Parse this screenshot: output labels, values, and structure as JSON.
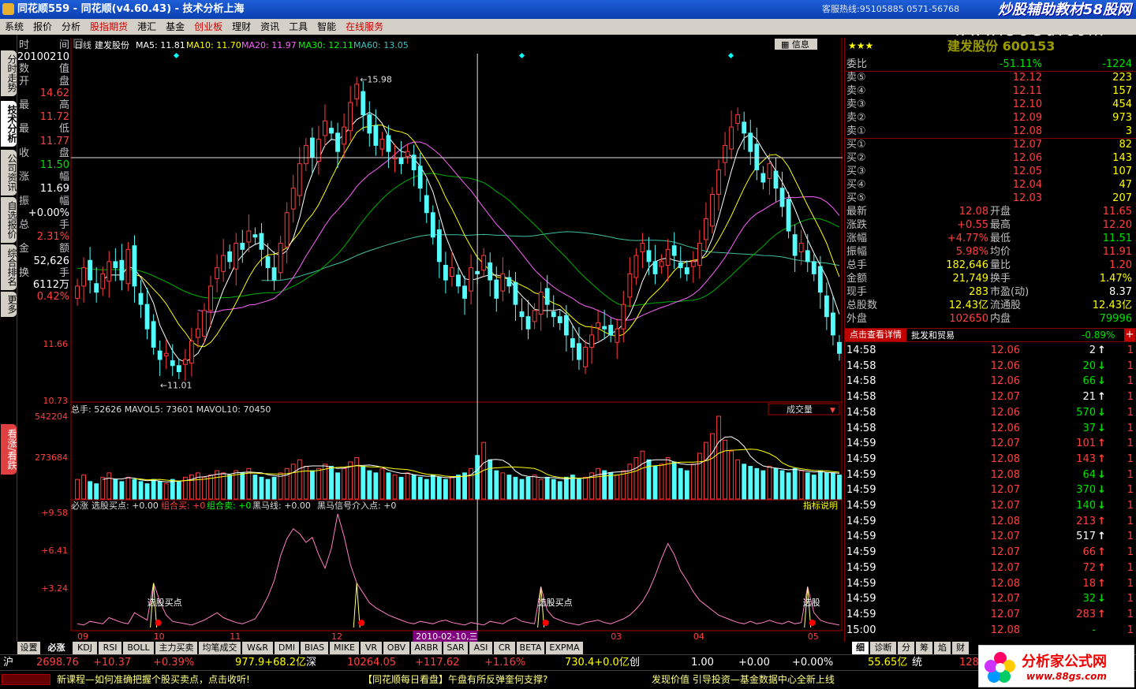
{
  "window": {
    "title": "同花顺559 - 同花顺(v4.60.43) - 技术分析上海",
    "hotline": "客服热线:95105885 0571-56768",
    "watermark": "炒股辅助教材58股网",
    "watermark_url": "www.58Gu.com"
  },
  "menu": [
    "系统",
    "报价",
    "分析",
    "股指期货",
    "港汇",
    "基金",
    "创业板",
    "理财",
    "资讯",
    "工具",
    "智能",
    "在线服务"
  ],
  "left_tabs": [
    "分时走势",
    "技术分析",
    "公司资讯",
    "自选报价",
    "综合排名",
    "更多"
  ],
  "left_tab_bottom": "看涨/看跌",
  "chart_header": {
    "period": "日线",
    "name": "建发股份",
    "ma5": "MA5: 11.81",
    "ma10": "MA10: 11.70",
    "ma20": "MA20: 11.97",
    "ma30": "MA30: 12.11",
    "ma60": "MA60: 13.05",
    "info_btn": "信息"
  },
  "info_panel": [
    {
      "k": "时",
      "v": "间"
    },
    {
      "k": "",
      "v": "20100210"
    },
    {
      "k": "数",
      "v": "值"
    },
    {
      "k": "开",
      "v": "盘"
    },
    {
      "k": "",
      "v": "14.62"
    },
    {
      "k": "最",
      "v": "高"
    },
    {
      "k": "",
      "v": "11.72"
    },
    {
      "k": "最",
      "v": "低"
    },
    {
      "k": "",
      "v": "11.77"
    },
    {
      "k": "收",
      "v": "盘"
    },
    {
      "k": "",
      "v": "11.50"
    },
    {
      "k": "涨",
      "v": "幅"
    },
    {
      "k": "",
      "v": "11.69"
    },
    {
      "k": "振",
      "v": "幅"
    },
    {
      "k": "",
      "v": "+0.00%"
    },
    {
      "k": "总",
      "v": "手"
    },
    {
      "k": "",
      "v": "2.31%"
    },
    {
      "k": "金",
      "v": "额"
    },
    {
      "k": "",
      "v": "52,626"
    },
    {
      "k": "换",
      "v": "手"
    },
    {
      "k": "",
      "v": "6112万"
    },
    {
      "k": "",
      "v": "0.42%"
    }
  ],
  "price_axis": {
    "high_label": "15.98",
    "low_label": "11.01",
    "y_mid": "11.66",
    "y_bottom": "10.73"
  },
  "volume_header": {
    "text": "总手: 52626 MAVOL5: 73601 MAVOL10: 70450",
    "selector": "成交量",
    "y_top": "542204",
    "y_mid": "273684"
  },
  "indicator_header": {
    "name": "必涨",
    "fields": "选股买点: +0.00",
    "combo_buy": "组合买: +0",
    "combo_sell": "组合卖: +0",
    "black_horse": "黑马线: +0.00",
    "signal": "黑马信号介入点: +0",
    "help": "指标说明",
    "y1": "+9.58",
    "y2": "+6.41",
    "y3": "+3.24",
    "buy_marker": "选股买点",
    "buy_marker2": "选股"
  },
  "x_axis": [
    "09",
    "10",
    "11",
    "12",
    "01",
    "03",
    "04",
    "05"
  ],
  "crosshair_date": "2010-02-10,三",
  "chart_data": {
    "type": "candlestick",
    "title": "建发股份 日线",
    "price_range": [
      10.73,
      16.4
    ],
    "labeled_high": 15.98,
    "labeled_low": 11.01,
    "closes": [
      12.6,
      12.9,
      12.7,
      12.5,
      12.8,
      13.0,
      12.9,
      12.7,
      13.2,
      12.6,
      12.3,
      11.9,
      11.6,
      11.4,
      11.5,
      11.3,
      11.2,
      11.4,
      11.7,
      11.9,
      12.2,
      12.6,
      12.9,
      13.1,
      13.0,
      13.3,
      13.2,
      13.5,
      13.4,
      13.2,
      12.9,
      12.7,
      13.3,
      13.8,
      14.2,
      14.6,
      14.9,
      14.7,
      15.0,
      15.3,
      15.1,
      14.8,
      15.2,
      15.6,
      15.9,
      15.4,
      15.1,
      14.9,
      15.0,
      14.8,
      14.7,
      14.6,
      14.8,
      14.5,
      14.2,
      13.8,
      13.4,
      13.0,
      12.7,
      12.9,
      12.6,
      12.4,
      12.9,
      12.8,
      13.1,
      12.7,
      12.4,
      12.8,
      12.6,
      12.3,
      12.1,
      11.9,
      12.2,
      12.5,
      12.3,
      12.1,
      12.0,
      11.8,
      11.6,
      11.4,
      11.6,
      11.8,
      12.0,
      11.9,
      11.8,
      11.9,
      12.3,
      12.8,
      13.1,
      13.3,
      13.0,
      12.8,
      13.0,
      13.2,
      13.1,
      12.9,
      12.8,
      13.0,
      13.3,
      13.7,
      14.1,
      14.5,
      14.9,
      15.2,
      15.4,
      15.1,
      14.8,
      14.5,
      14.3,
      14.6,
      14.2,
      13.9,
      13.5,
      13.1,
      13.3,
      13.0,
      12.8,
      12.5,
      12.1,
      11.8,
      11.5
    ],
    "volume_range": [
      0,
      542204
    ],
    "volumes": [
      9,
      11,
      8,
      7,
      10,
      12,
      9,
      8,
      10,
      9,
      8,
      7,
      9,
      8,
      7,
      9,
      8,
      10,
      11,
      12,
      10,
      11,
      13,
      12,
      11,
      13,
      12,
      14,
      11,
      10,
      9,
      10,
      12,
      14,
      16,
      18,
      15,
      13,
      14,
      16,
      15,
      12,
      14,
      17,
      19,
      15,
      13,
      12,
      14,
      12,
      11,
      10,
      12,
      11,
      10,
      9,
      11,
      10,
      9,
      10,
      11,
      12,
      14,
      20,
      26,
      18,
      13,
      12,
      11,
      10,
      9,
      10,
      11,
      9,
      10,
      9,
      8,
      10,
      11,
      9,
      10,
      12,
      14,
      13,
      12,
      11,
      13,
      16,
      19,
      22,
      18,
      15,
      16,
      19,
      17,
      14,
      13,
      16,
      21,
      26,
      30,
      38,
      27,
      22,
      18,
      16,
      15,
      14,
      13,
      15,
      14,
      13,
      12,
      14,
      13,
      12,
      11,
      13,
      12,
      12,
      11
    ],
    "indicator_range": [
      0,
      9.58
    ],
    "indicator": [
      0.3,
      0.2,
      0.5,
      0.4,
      0.3,
      0.8,
      0.6,
      0.4,
      0.3,
      1.2,
      0.9,
      0.6,
      3.6,
      2.1,
      1.0,
      0.5,
      0.4,
      0.3,
      0.2,
      0.4,
      0.6,
      0.9,
      1.2,
      0.8,
      0.6,
      0.4,
      0.3,
      0.5,
      0.7,
      1.5,
      2.5,
      3.8,
      5.8,
      7.2,
      8.0,
      7.6,
      6.9,
      7.3,
      5.9,
      4.8,
      6.4,
      9.2,
      7.4,
      5.1,
      3.6,
      2.8,
      2.0,
      1.6,
      1.3,
      1.0,
      0.8,
      0.6,
      0.4,
      0.3,
      0.5,
      0.4,
      0.3,
      0.5,
      0.6,
      0.4,
      0.3,
      0.2,
      0.4,
      0.3,
      0.2,
      0.5,
      0.4,
      0.3,
      0.6,
      0.8,
      0.5,
      0.4,
      0.3,
      3.3,
      1.4,
      0.8,
      0.6,
      0.4,
      0.3,
      0.2,
      0.4,
      0.5,
      0.6,
      0.4,
      0.3,
      0.5,
      0.7,
      1.0,
      1.5,
      2.1,
      3.0,
      4.2,
      5.6,
      6.8,
      5.9,
      4.6,
      3.8,
      2.9,
      2.2,
      1.8,
      1.4,
      1.0,
      0.8,
      0.6,
      0.4,
      0.3,
      0.5,
      0.3,
      0.4,
      0.6,
      0.4,
      0.3,
      0.5,
      0.3,
      0.4,
      3.3,
      1.2,
      0.6,
      0.4,
      0.3,
      0.2
    ]
  },
  "stock_panel": {
    "title": "建发股份 600153",
    "stars": "★★★",
    "order_book": [
      {
        "k": "委比",
        "v": "-51.11%",
        "n": "-1224",
        "vc": "grn",
        "nc": "grn"
      },
      {
        "k": "卖⑤",
        "v": "12.12",
        "n": "223",
        "vc": "red",
        "nc": "yel"
      },
      {
        "k": "卖④",
        "v": "12.11",
        "n": "157",
        "vc": "red",
        "nc": "yel"
      },
      {
        "k": "卖③",
        "v": "12.10",
        "n": "454",
        "vc": "red",
        "nc": "yel"
      },
      {
        "k": "卖②",
        "v": "12.09",
        "n": "973",
        "vc": "red",
        "nc": "yel"
      },
      {
        "k": "卖①",
        "v": "12.08",
        "n": "3",
        "vc": "red",
        "nc": "yel"
      },
      {
        "k": "买①",
        "v": "12.07",
        "n": "82",
        "vc": "red",
        "nc": "yel"
      },
      {
        "k": "买②",
        "v": "12.06",
        "n": "143",
        "vc": "red",
        "nc": "yel"
      },
      {
        "k": "买③",
        "v": "12.05",
        "n": "107",
        "vc": "red",
        "nc": "yel"
      },
      {
        "k": "买④",
        "v": "12.04",
        "n": "47",
        "vc": "red",
        "nc": "yel"
      },
      {
        "k": "买⑤",
        "v": "12.03",
        "n": "207",
        "vc": "red",
        "nc": "yel"
      }
    ],
    "stats": [
      {
        "k": "最新",
        "v": "12.08",
        "vc": "red",
        "k2": "开盘",
        "v2": "11.65",
        "v2c": "red"
      },
      {
        "k": "涨跌",
        "v": "+0.55",
        "vc": "red",
        "k2": "最高",
        "v2": "12.20",
        "v2c": "red"
      },
      {
        "k": "涨幅",
        "v": "+4.77%",
        "vc": "red",
        "k2": "最低",
        "v2": "11.51",
        "v2c": "grn"
      },
      {
        "k": "振幅",
        "v": "5.98%",
        "vc": "red",
        "k2": "均价",
        "v2": "11.91",
        "v2c": "red"
      },
      {
        "k": "总手",
        "v": "182,646",
        "vc": "yel",
        "k2": "量比",
        "v2": "1.20",
        "v2c": "red"
      },
      {
        "k": "金额",
        "v": "21,749",
        "vc": "yel",
        "k2": "换手",
        "v2": "1.47%",
        "v2c": "yel"
      },
      {
        "k": "现手",
        "v": "283",
        "vc": "yel",
        "k2": "市盈(动)",
        "v2": "8.37",
        "v2c": "wht"
      },
      {
        "k": "总股数",
        "v": "12.43亿",
        "vc": "yel",
        "k2": "流通股",
        "v2": "12.43亿",
        "v2c": "yel"
      },
      {
        "k": "外盘",
        "v": "102650",
        "vc": "red",
        "k2": "内盘",
        "v2": "79996",
        "v2c": "grn"
      }
    ],
    "detail_btn": "点击查看详情",
    "industry": "批发和贸易",
    "industry_pct": "-0.89%",
    "plus": "+",
    "ticks": [
      {
        "t": "14:58",
        "p": "12.06",
        "pc": "red",
        "v": "2",
        "d": "up",
        "vc": "wht"
      },
      {
        "t": "14:58",
        "p": "12.06",
        "pc": "red",
        "v": "20",
        "d": "dn",
        "vc": "grn"
      },
      {
        "t": "14:58",
        "p": "12.06",
        "pc": "red",
        "v": "66",
        "d": "dn",
        "vc": "grn"
      },
      {
        "t": "14:58",
        "p": "12.07",
        "pc": "red",
        "v": "21",
        "d": "up",
        "vc": "wht"
      },
      {
        "t": "14:58",
        "p": "12.06",
        "pc": "red",
        "v": "570",
        "d": "dn",
        "vc": "grn"
      },
      {
        "t": "14:58",
        "p": "12.06",
        "pc": "red",
        "v": "37",
        "d": "dn",
        "vc": "grn"
      },
      {
        "t": "14:59",
        "p": "12.07",
        "pc": "red",
        "v": "101",
        "d": "up",
        "vc": "red"
      },
      {
        "t": "14:59",
        "p": "12.08",
        "pc": "red",
        "v": "143",
        "d": "up",
        "vc": "red"
      },
      {
        "t": "14:59",
        "p": "12.08",
        "pc": "red",
        "v": "64",
        "d": "dn",
        "vc": "grn"
      },
      {
        "t": "14:59",
        "p": "12.07",
        "pc": "red",
        "v": "370",
        "d": "dn",
        "vc": "grn"
      },
      {
        "t": "14:59",
        "p": "12.07",
        "pc": "red",
        "v": "140",
        "d": "dn",
        "vc": "grn"
      },
      {
        "t": "14:59",
        "p": "12.08",
        "pc": "red",
        "v": "213",
        "d": "up",
        "vc": "red"
      },
      {
        "t": "14:59",
        "p": "12.07",
        "pc": "red",
        "v": "517",
        "d": "up",
        "vc": "wht"
      },
      {
        "t": "14:59",
        "p": "12.07",
        "pc": "red",
        "v": "66",
        "d": "up",
        "vc": "red"
      },
      {
        "t": "14:59",
        "p": "12.07",
        "pc": "red",
        "v": "72",
        "d": "up",
        "vc": "red"
      },
      {
        "t": "14:59",
        "p": "12.08",
        "pc": "red",
        "v": "18",
        "d": "up",
        "vc": "red"
      },
      {
        "t": "14:59",
        "p": "12.07",
        "pc": "red",
        "v": "32",
        "d": "dn",
        "vc": "grn"
      },
      {
        "t": "14:59",
        "p": "12.07",
        "pc": "red",
        "v": "283",
        "d": "up",
        "vc": "red"
      },
      {
        "t": "15:00",
        "p": "12.08",
        "pc": "red",
        "v": "-",
        "d": "",
        "vc": "grn"
      }
    ],
    "tick_count": "1",
    "bottom_tabs": [
      "细",
      "诊断",
      "分",
      "筹",
      "焰",
      "财"
    ]
  },
  "bottom_tabs": [
    "设置",
    "必涨",
    "KDJ",
    "RSI",
    "BOLL",
    "主力买卖",
    "均笔成交",
    "W&R",
    "DMI",
    "BIAS",
    "MIKE",
    "VR",
    "OBV",
    "ARBR",
    "SAR",
    "ASI",
    "CR",
    "BETA",
    "EXPMA"
  ],
  "quote_bar": {
    "sh_label": "沪",
    "sh_index": "2698.76",
    "sh_chg": "+10.37",
    "sh_pct": "+0.39%",
    "sh_amt": "977.9+68.2亿",
    "sz_label": "深",
    "sz_index": "10264.05",
    "sz_chg": "+117.62",
    "sz_pct": "+1.16%",
    "sz_amt": "730.4+0.0亿",
    "cy_label": "创",
    "cy_index": "1.00",
    "cy_chg": "+0.00",
    "cy_pct": "+0.00%",
    "cy_amt": "55.65亿",
    "ty_label": "统",
    "ty_index": "1286"
  },
  "news": [
    "新课程—如何准确把握个股买卖点，点击收听!",
    "【同花顺每日看盘】午盘有所反弹奎何支撑?",
    "发现价值 引导投资—基金数据中心全新上线"
  ],
  "logo": {
    "text": "分析家公式网",
    "url": "www.88gs.com"
  }
}
